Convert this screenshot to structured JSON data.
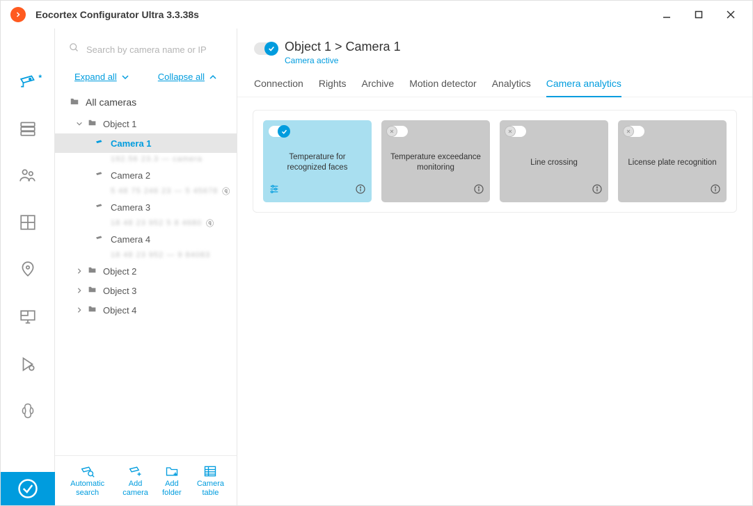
{
  "app": {
    "title": "Eocortex Configurator Ultra 3.3.38s"
  },
  "search": {
    "placeholder": "Search by camera name or IP"
  },
  "links": {
    "expand": "Expand all",
    "collapse": "Collapse all"
  },
  "tree": {
    "root": "All cameras",
    "objects": [
      {
        "name": "Object 1",
        "expanded": true,
        "cameras": [
          {
            "name": "Camera 1",
            "selected": true
          },
          {
            "name": "Camera 2"
          },
          {
            "name": "Camera 3"
          },
          {
            "name": "Camera 4"
          }
        ]
      },
      {
        "name": "Object 2",
        "expanded": false
      },
      {
        "name": "Object 3",
        "expanded": false
      },
      {
        "name": "Object 4",
        "expanded": false
      }
    ]
  },
  "actions": {
    "auto_search": "Automatic search",
    "add_camera": "Add camera",
    "add_folder": "Add folder",
    "camera_table": "Camera table"
  },
  "header": {
    "breadcrumb": "Object 1 > Camera 1",
    "status": "Camera active"
  },
  "tabs": [
    "Connection",
    "Rights",
    "Archive",
    "Motion detector",
    "Analytics",
    "Camera analytics"
  ],
  "active_tab": 5,
  "analytics": [
    {
      "name": "Temperature for recognized faces",
      "enabled": true,
      "has_settings": true
    },
    {
      "name": "Temperature exceedance monitoring",
      "enabled": false
    },
    {
      "name": "Line crossing",
      "enabled": false
    },
    {
      "name": "License plate recognition",
      "enabled": false
    }
  ]
}
